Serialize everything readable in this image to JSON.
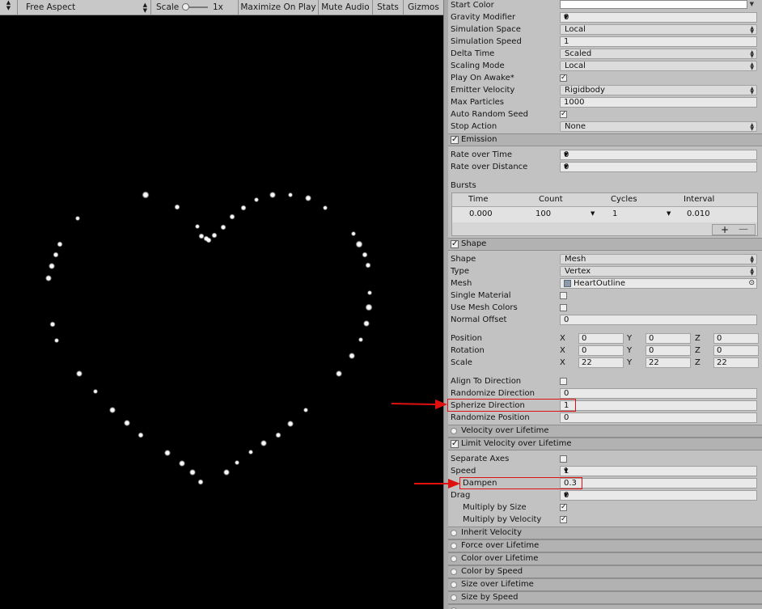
{
  "toolbar": {
    "display_label": "Free Aspect",
    "scale_label": "Scale",
    "scale_value": "1x",
    "scale_slider_value": 0,
    "maximize_label": "Maximize On Play",
    "mute_label": "Mute Audio",
    "stats_label": "Stats",
    "gizmos_label": "Gizmos"
  },
  "game_view": {
    "background": "#000000",
    "particle_color": "#ffffff",
    "particle_count": 60,
    "shape": "heart outline"
  },
  "inspector": {
    "main": [
      {
        "label": "Start Color",
        "type": "color",
        "value": "#ffffff"
      },
      {
        "label": "Gravity Modifier",
        "type": "dropdown-arrow",
        "value": "0"
      },
      {
        "label": "Simulation Space",
        "type": "dropdown",
        "value": "Local"
      },
      {
        "label": "Simulation Speed",
        "type": "text",
        "value": "1"
      },
      {
        "label": "Delta Time",
        "type": "dropdown",
        "value": "Scaled"
      },
      {
        "label": "Scaling Mode",
        "type": "dropdown",
        "value": "Local"
      },
      {
        "label": "Play On Awake*",
        "type": "checkbox",
        "checked": true
      },
      {
        "label": "Emitter Velocity",
        "type": "dropdown",
        "value": "Rigidbody"
      },
      {
        "label": "Max Particles",
        "type": "text",
        "value": "1000"
      },
      {
        "label": "Auto Random Seed",
        "type": "checkbox",
        "checked": true
      },
      {
        "label": "Stop Action",
        "type": "dropdown",
        "value": "None"
      }
    ],
    "emission": {
      "title": "Emission",
      "rate_over_time_label": "Rate over Time",
      "rate_over_time": "0",
      "rate_over_distance_label": "Rate over Distance",
      "rate_over_distance": "0",
      "bursts_label": "Bursts",
      "bursts_columns": [
        "Time",
        "Count",
        "Cycles",
        "Interval"
      ],
      "bursts_rows": [
        {
          "time": "0.000",
          "count": "100",
          "cycles": "1",
          "interval": "0.010"
        }
      ],
      "add_symbol": "+",
      "remove_symbol": "—"
    },
    "shape": {
      "title": "Shape",
      "shape_label": "Shape",
      "shape": "Mesh",
      "type_label": "Type",
      "type": "Vertex",
      "mesh_label": "Mesh",
      "mesh": "HeartOutline",
      "single_material_label": "Single Material",
      "use_mesh_colors_label": "Use Mesh Colors",
      "normal_offset_label": "Normal Offset",
      "normal_offset": "0",
      "position_label": "Position",
      "position": [
        "0",
        "0",
        "0"
      ],
      "rotation_label": "Rotation",
      "rotation": [
        "0",
        "0",
        "0"
      ],
      "scale_label": "Scale",
      "scale": [
        "22",
        "22",
        "22"
      ],
      "axis_x": "X",
      "axis_y": "Y",
      "axis_z": "Z",
      "align_label": "Align To Direction",
      "randomize_dir_label": "Randomize Direction",
      "randomize_dir": "0",
      "spherize_label": "Spherize Direction",
      "spherize": "1",
      "randomize_pos_label": "Randomize Position",
      "randomize_pos": "0"
    },
    "velocity_over_lifetime": "Velocity over Lifetime",
    "limit_velocity": {
      "title": "Limit Velocity over Lifetime",
      "separate_axes_label": "Separate Axes",
      "speed_label": "Speed",
      "speed": "1",
      "dampen_label": "Dampen",
      "dampen": "0.3",
      "drag_label": "Drag",
      "drag": "0",
      "multiply_size_label": "Multiply by Size",
      "multiply_velocity_label": "Multiply by Velocity"
    },
    "modules": [
      "Inherit Velocity",
      "Force over Lifetime",
      "Color over Lifetime",
      "Color by Speed",
      "Size over Lifetime",
      "Size by Speed"
    ]
  },
  "annotation_color": "#e01010"
}
